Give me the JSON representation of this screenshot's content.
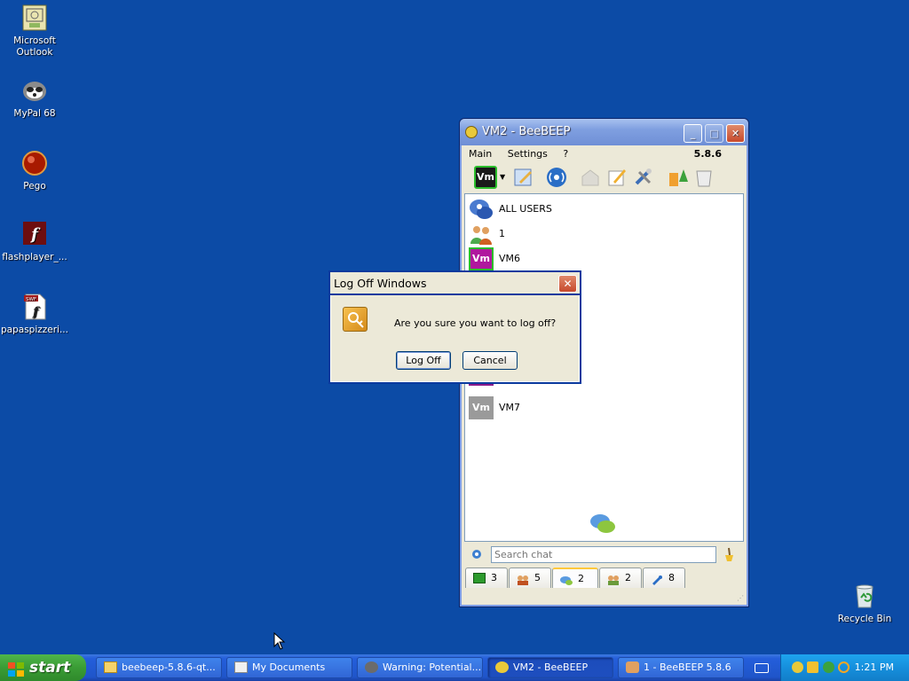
{
  "desktop": {
    "icons": [
      {
        "name": "outlook",
        "label": "Microsoft Outlook",
        "icon": "outlook-icon"
      },
      {
        "name": "mypal",
        "label": "MyPal 68",
        "icon": "mypal-raccoon-icon"
      },
      {
        "name": "pego",
        "label": "Pego",
        "icon": "pego-orb-icon"
      },
      {
        "name": "flashplayer",
        "label": "flashplayer_...",
        "icon": "flash-player-icon"
      },
      {
        "name": "papaspizzeria",
        "label": "papaspizzeri...",
        "icon": "swf-file-icon"
      },
      {
        "name": "recycle-bin",
        "label": "Recycle Bin",
        "icon": "recycle-bin-icon"
      }
    ]
  },
  "beebeep": {
    "title": "VM2 - BeeBEEP",
    "menu": [
      "Main",
      "Settings",
      "?"
    ],
    "version": "5.8.6",
    "users": [
      {
        "label": "ALL USERS",
        "avatar": "group-chat-icon"
      },
      {
        "label": "1",
        "avatar": "group-users-icon"
      },
      {
        "label": "VM6",
        "avatar_text": "Vm",
        "color": "#b0189e"
      },
      {
        "label": "VM7",
        "avatar_text": "Vm",
        "color": "#9a9a9a"
      }
    ],
    "search_placeholder": "Search chat",
    "tabs": [
      {
        "icon": "users-online-icon",
        "count": "3"
      },
      {
        "icon": "users-group-icon",
        "count": "5"
      },
      {
        "icon": "chat-icon",
        "count": "2"
      },
      {
        "icon": "groups-icon",
        "count": "2"
      },
      {
        "icon": "shares-icon",
        "count": "8"
      }
    ],
    "toolbar_avatar_text": "Vm"
  },
  "logoff_dialog": {
    "title": "Log Off Windows",
    "message": "Are you sure you want to log off?",
    "ok_label": "Log Off",
    "cancel_label": "Cancel",
    "close_glyph": "✕"
  },
  "taskbar": {
    "start_label": "start",
    "tasks": [
      {
        "label": "beebeep-5.8.6-qt...",
        "icon": "folder-icon"
      },
      {
        "label": "My Documents",
        "icon": "documents-icon"
      },
      {
        "label": "Warning: Potential...",
        "icon": "warning-browser-icon"
      },
      {
        "label": "VM2 - BeeBEEP",
        "icon": "beebeep-icon"
      },
      {
        "label": "1 - BeeBEEP 5.8.6",
        "icon": "beebeep-group-icon"
      }
    ],
    "clock": "1:21 PM"
  },
  "colors": {
    "desktop_bg": "#0c4ba6",
    "xp_blue": "#245edb",
    "start_green": "#3a9c35"
  }
}
